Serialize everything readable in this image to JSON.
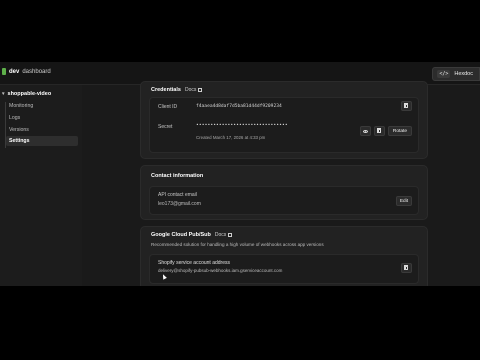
{
  "topbar": {
    "brand_bold": "dev",
    "brand_sub": "dashboard",
    "header_button_icon": "</>",
    "header_button_label": "Hexdoc"
  },
  "sidebar": {
    "app_name": "shoppable-video",
    "items": [
      {
        "label": "Monitoring",
        "active": false
      },
      {
        "label": "Logs",
        "active": false
      },
      {
        "label": "Versions",
        "active": false
      },
      {
        "label": "Settings",
        "active": true
      }
    ]
  },
  "credentials": {
    "title": "Credentials",
    "docs_label": "Docs",
    "client_id_label": "Client ID",
    "client_id_value": "f4aaea4d8daf7d5ba81d44df9209234",
    "secret_label": "Secret",
    "secret_value": "••••••••••••••••••••••••••••••••",
    "created_text": "Created March 17, 2026 at 4:33 pm",
    "rotate_label": "Rotate"
  },
  "contact": {
    "title": "Contact information",
    "email_label": "API contact email",
    "email_value": "leo173@gmail.com",
    "edit_label": "Edit"
  },
  "pubsub": {
    "title": "Google Cloud Pub/Sub",
    "docs_label": "Docs",
    "description": "Recommended solution for handling a high volume of webhooks across app versions",
    "service_account_label": "Shopify service account address",
    "service_account_value": "delivery@shopify-pubsub-webhooks.iam.gserviceaccount.com"
  },
  "colors": {
    "brand_green": "#5eb04a",
    "surface": "#1a1a1a",
    "card": "#222222"
  },
  "icons": [
    "code-icon",
    "chevron-down-icon",
    "external-link-icon",
    "copy-icon",
    "eye-icon",
    "trash-icon"
  ]
}
